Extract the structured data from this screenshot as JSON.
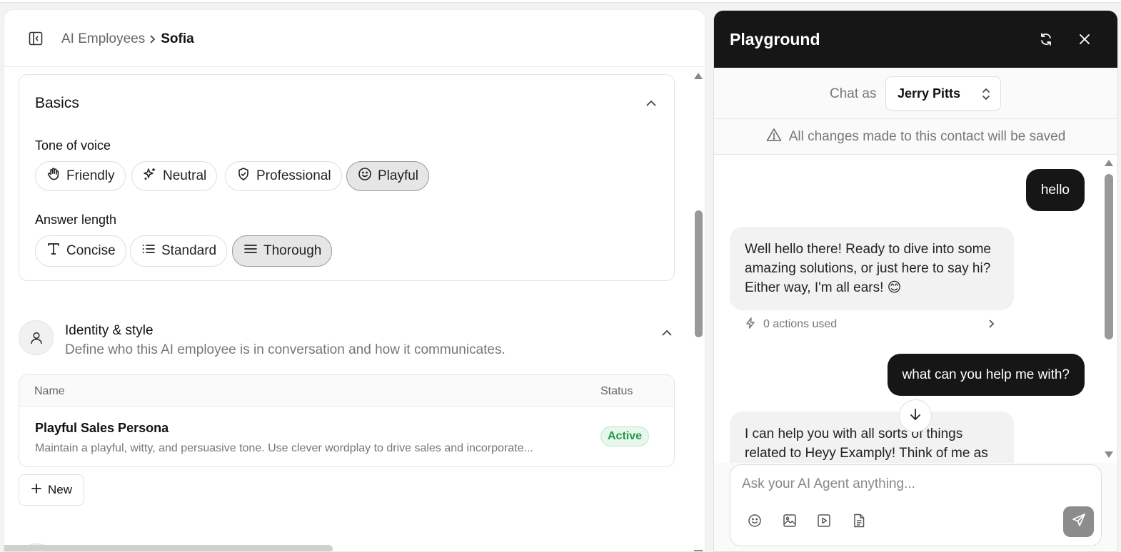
{
  "breadcrumb": {
    "parent": "AI Employees",
    "current": "Sofia"
  },
  "basics": {
    "title": "Basics",
    "tone_label": "Tone of voice",
    "tones": [
      {
        "label": "Friendly",
        "icon": "hand-icon",
        "selected": false
      },
      {
        "label": "Neutral",
        "icon": "sparkles-icon",
        "selected": false
      },
      {
        "label": "Professional",
        "icon": "shield-icon",
        "selected": false
      },
      {
        "label": "Playful",
        "icon": "smile-icon",
        "selected": true
      }
    ],
    "length_label": "Answer length",
    "lengths": [
      {
        "label": "Concise",
        "icon": "type-icon",
        "selected": false
      },
      {
        "label": "Standard",
        "icon": "list-icon",
        "selected": false
      },
      {
        "label": "Thorough",
        "icon": "menu-lines-icon",
        "selected": true
      }
    ]
  },
  "identity": {
    "title": "Identity & style",
    "description": "Define who this AI employee is in conversation and how it communicates.",
    "table": {
      "headers": {
        "name": "Name",
        "status": "Status"
      },
      "rows": [
        {
          "title": "Playful Sales Persona",
          "description": "Maintain a playful, witty, and persuasive tone. Use clever wordplay to drive sales and incorporate...",
          "status": "Active",
          "status_color": "#1f9a43"
        }
      ]
    },
    "new_button": "New"
  },
  "playground": {
    "title": "Playground",
    "chat_as_label": "Chat as",
    "contact": "Jerry Pitts",
    "warning": "All changes made to this contact will be saved",
    "messages": [
      {
        "role": "user",
        "text": "hello"
      },
      {
        "role": "ai",
        "text": "Well hello there! Ready to dive into some amazing solutions, or just here to say hi? Either way, I'm all ears! 😊",
        "actions": "0 actions used"
      },
      {
        "role": "user",
        "text": "what can you help me with?"
      },
      {
        "role": "ai",
        "text": "I can help you with all sorts of things related to Heyy Examply! Think of me as"
      }
    ],
    "composer_placeholder": "Ask your AI Agent anything..."
  },
  "colors": {
    "header_dark": "#161616",
    "active_green": "#1f9a43",
    "selected_pill": "#e6e6e6"
  }
}
